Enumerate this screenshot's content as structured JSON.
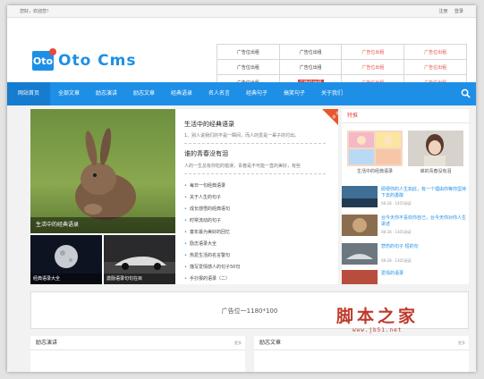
{
  "topbar": {
    "greeting": "您好，欢迎您！",
    "login": "注册",
    "register": "登录"
  },
  "logo": {
    "mark": "Oto",
    "text": "Oto Cms"
  },
  "ads": [
    [
      "广告位出租",
      "广告位出租",
      "广告位出租",
      "广告位出租"
    ],
    [
      "广告位出租",
      "广告位出租",
      "广告位出租",
      "广告位出租"
    ],
    [
      "广告位出租",
      "广告位出租",
      "广告位出租",
      "广告位出租"
    ]
  ],
  "nav": {
    "items": [
      "网站首页",
      "全部文章",
      "励志演讲",
      "励志文章",
      "经典语录",
      "名人名言",
      "经典句子",
      "搞笑句子",
      "关于我们"
    ]
  },
  "featured": {
    "caption": "生活中的经典语录"
  },
  "thumbs": [
    {
      "caption": "经典语录大全"
    },
    {
      "caption": "激励语录句句在目"
    }
  ],
  "news": {
    "corner_label": "推荐",
    "headline1": "生活中的经典语录",
    "desc1": "1、别人说我们的不是一瞬间，而人的爱是一辈子的付出。",
    "headline2": "谁的青春没有泪",
    "desc2": "人的一生总有你犯的错误，青春是不可能一直的美好，有些",
    "list": [
      "每日一句经典语录",
      "关于人生的句子",
      "成长感悟的经典语句",
      "时常流动的句子",
      "童年最为美好的回忆",
      "励志语录大全",
      "热爱生活的名言警句",
      "描写爱情感人的句子50句",
      "手抄报的语录（二）"
    ]
  },
  "side": {
    "title": "特推",
    "top": [
      {
        "caption": "生活中的经典语录"
      },
      {
        "caption": "谁的青春没有泪"
      }
    ],
    "rows": [
      {
        "title": "即便你的人生如此，有一个理由你等你坚持下去的勇敢",
        "meta": "08-28 · 1455阅读"
      },
      {
        "title": "台今天你不喜欢你自己，台今天你对你人生讲述",
        "meta": "08-28 · 1305阅读"
      },
      {
        "title": "悲伤的句子 短的句",
        "meta": "08-28 · 1305阅读"
      },
      {
        "title": "爱情的语录",
        "meta": "08-28 · 1305阅读"
      }
    ]
  },
  "banner": "广告位一1180*100",
  "panels": [
    {
      "title": "励志演讲",
      "more": "更多"
    },
    {
      "title": "励志文章",
      "more": "更多"
    }
  ],
  "watermark": {
    "big": "脚本之家",
    "url": "www.jb51.net"
  }
}
